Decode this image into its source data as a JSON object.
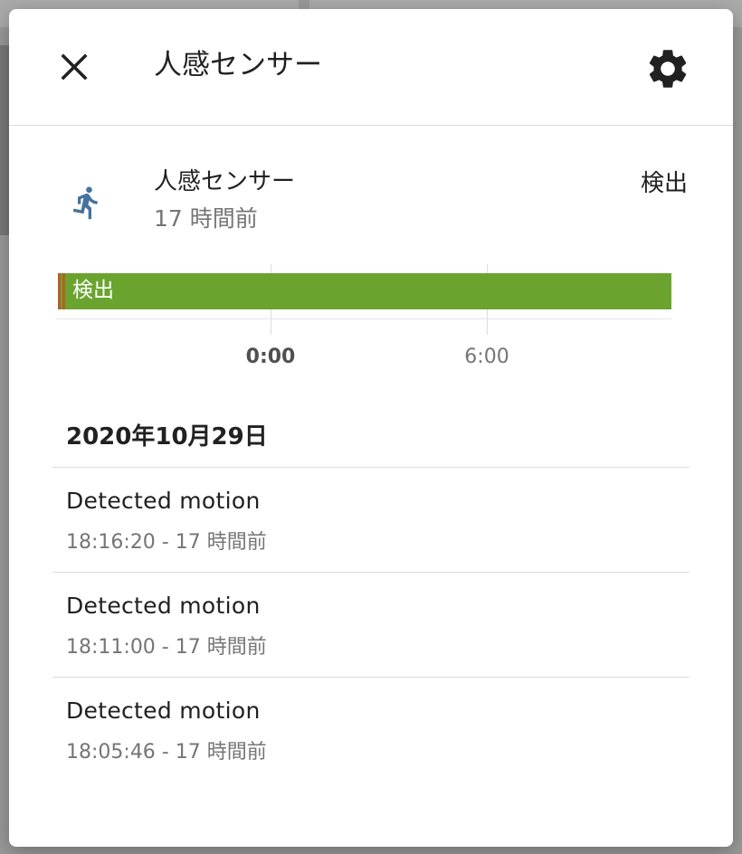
{
  "dialog": {
    "title": "人感センサー",
    "close_icon": "close-icon",
    "settings_icon": "gear-icon"
  },
  "entity": {
    "icon": "motion-sensor-icon",
    "name": "人感センサー",
    "last_changed": "17 時間前",
    "state": "検出"
  },
  "history": {
    "bar_label": "検出",
    "ticks": [
      "0:00",
      "6:00"
    ],
    "colors": {
      "detected": "#6aa42f",
      "clear": "#b0622a"
    }
  },
  "logbook": {
    "date": "2020年10月29日",
    "entries": [
      {
        "message": "Detected motion",
        "time": "18:16:20 - 17 時間前"
      },
      {
        "message": "Detected motion",
        "time": "18:11:00 - 17 時間前"
      },
      {
        "message": "Detected motion",
        "time": "18:05:46 - 17 時間前"
      }
    ]
  }
}
